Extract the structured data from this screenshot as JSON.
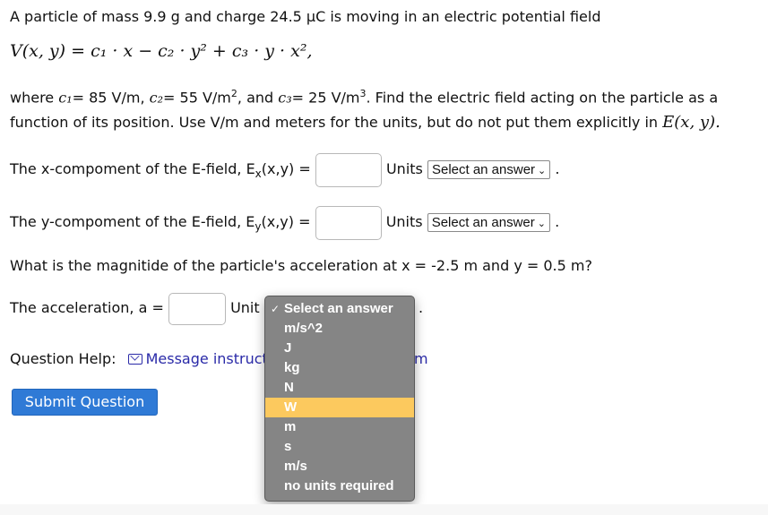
{
  "problem": {
    "intro": "A particle of mass 9.9 g and charge 24.5 μC is moving in an electric potential field",
    "equation": "V(x, y) = c₁ · x − c₂ · y² + c₃ · y · x²,",
    "constants_prefix": "where",
    "c1_label": "c₁",
    "c1_value": "= 85 V/m,",
    "c2_label": "c₂",
    "c2_value": "= 55 V/m",
    "c2_exp": "2",
    "c2_suffix": ", and",
    "c3_label": "c₃",
    "c3_value": "= 25 V/m",
    "c3_exp": "3",
    "c3_suffix": ". Find the electric field acting on the particle as a",
    "line3": "function of its position. Use V/m and meters for the units, but do not put them explicitly in",
    "efield_symbol": "E",
    "efield_args": "(x, y)."
  },
  "questions": {
    "ex": {
      "label_pre": "The x-compoment of the E-field, E",
      "label_sub": "x",
      "label_post": "(x,y) =",
      "value": "",
      "units_label": "Units",
      "select": "Select an answer",
      "end": "."
    },
    "ey": {
      "label_pre": "The y-compoment of the E-field, E",
      "label_sub": "y",
      "label_post": "(x,y) =",
      "value": "",
      "units_label": "Units",
      "select": "Select an answer",
      "end": "."
    },
    "accel_question": "What is the magnitide of the particle's acceleration at x = -2.5 m and y = 0.5 m?",
    "accel": {
      "label": "The acceleration, a =",
      "value": "",
      "units_label": "Unit",
      "end": "."
    }
  },
  "help": {
    "label": "Question Help:",
    "link": "Message instructor",
    "link_tail": "m"
  },
  "submit_label": "Submit Question",
  "dropdown": {
    "options": [
      "Select an answer",
      "m/s^2",
      "J",
      "kg",
      "N",
      "W",
      "m",
      "s",
      "m/s",
      "no units required"
    ],
    "checked": "Select an answer",
    "highlighted": "W",
    "highlight_color": "#fcc95e"
  }
}
